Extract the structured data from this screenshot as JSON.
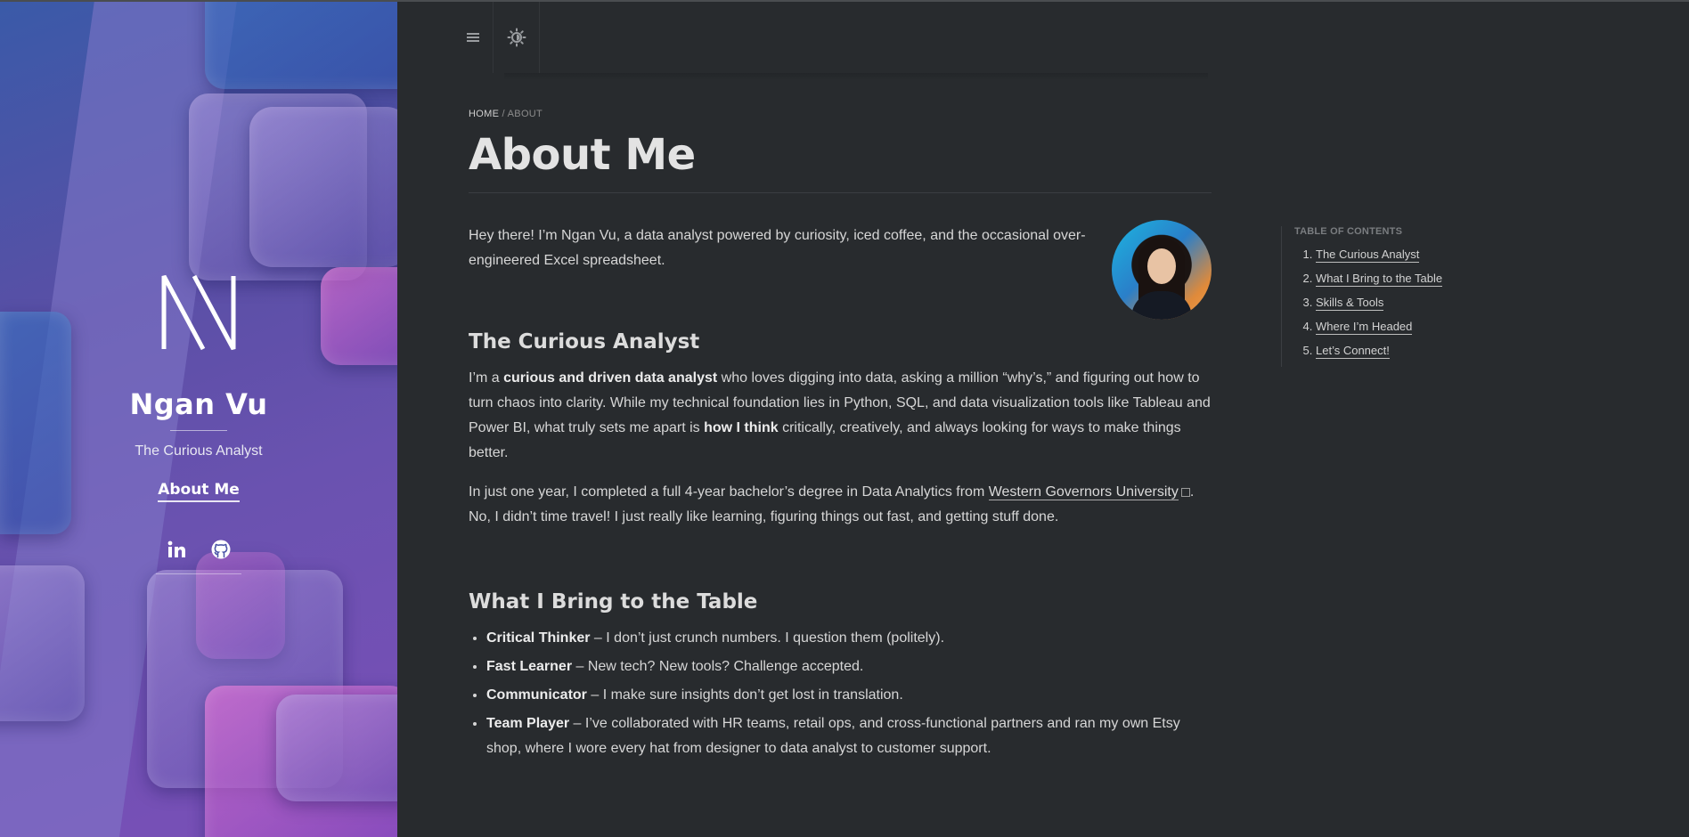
{
  "sidebar": {
    "name": "Ngan Vu",
    "tagline": "The Curious Analyst",
    "nav_about": "About Me",
    "social": [
      "linkedin-icon",
      "github-icon"
    ]
  },
  "breadcrumb": {
    "home": "HOME",
    "sep": " / ",
    "current": "ABOUT"
  },
  "page_title": "About Me",
  "intro": "Hey there! I’m Ngan Vu, a data analyst powered by curiosity, iced coffee, and the occasional over-engineered Excel spreadsheet.",
  "section1": {
    "heading": "The Curious Analyst",
    "p1_a": "I’m a ",
    "p1_b": "curious and driven data analyst",
    "p1_c": " who loves digging into data, asking a million “why’s,” and figuring out how to turn chaos into clarity. While my technical foundation lies in Python, SQL, and data visualization tools like Tableau and Power BI, what truly sets me apart is ",
    "p1_d": "how I think",
    "p1_e": " critically, creatively, and always looking for ways to make things better.",
    "p2_a": "In just one year, I completed a full 4-year bachelor’s degree in Data Analytics from ",
    "p2_link": "Western Governors University",
    "p2_b": ". No, I didn’t time travel! I just really like learning, figuring things out fast, and getting stuff done."
  },
  "section2": {
    "heading": "What I Bring to the Table",
    "items": [
      {
        "title": "Critical Thinker",
        "text": " – I don’t just crunch numbers. I question them (politely)."
      },
      {
        "title": "Fast Learner",
        "text": " – New tech? New tools? Challenge accepted."
      },
      {
        "title": "Communicator",
        "text": " – I make sure insights don’t get lost in translation."
      },
      {
        "title": "Team Player",
        "text": " – I’ve collaborated with HR teams, retail ops, and cross-functional partners and ran my own Etsy shop, where I wore every hat from designer to data analyst to customer support."
      }
    ]
  },
  "toc": {
    "title": "TABLE OF CONTENTS",
    "items": [
      "The Curious Analyst",
      "What I Bring to the Table",
      "Skills & Tools",
      "Where I’m Headed",
      "Let’s Connect!"
    ]
  },
  "toolbar": {
    "icons": [
      "menu-icon",
      "theme-toggle-icon"
    ]
  }
}
